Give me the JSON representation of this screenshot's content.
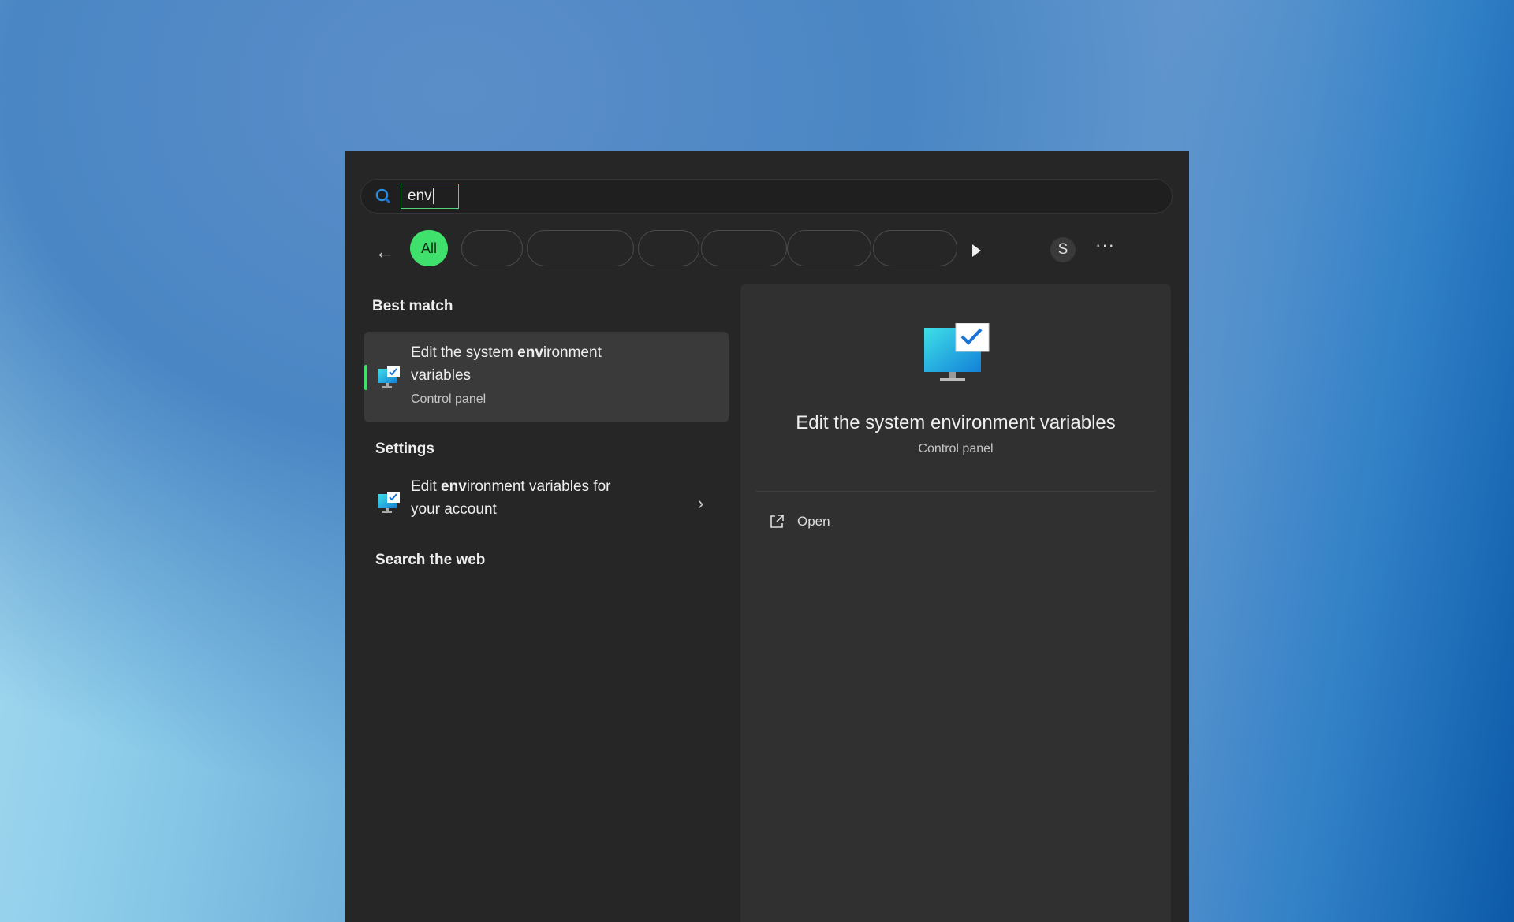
{
  "search": {
    "query": "env",
    "icon": "search-icon"
  },
  "filters": {
    "active": "All",
    "tabs": [
      "All",
      "",
      "",
      "",
      "",
      "",
      ""
    ]
  },
  "account": {
    "initial": "S"
  },
  "more": "···",
  "sections": {
    "best_match": "Best match",
    "settings": "Settings",
    "search_web": "Search the web"
  },
  "best_match": {
    "title_pre": "Edit the system ",
    "title_bold": "env",
    "title_post": "ironment",
    "title_line2": "variables",
    "subtitle": "Control panel"
  },
  "settings_item": {
    "pre": "Edit ",
    "bold": "env",
    "post": "ironment variables for",
    "line2": "your account"
  },
  "preview": {
    "title": "Edit the system environment variables",
    "subtitle": "Control panel",
    "actions": [
      {
        "label": "Open",
        "icon": "open-external-icon"
      }
    ]
  },
  "colors": {
    "accent": "#3fe06b",
    "panel": "#262626"
  }
}
